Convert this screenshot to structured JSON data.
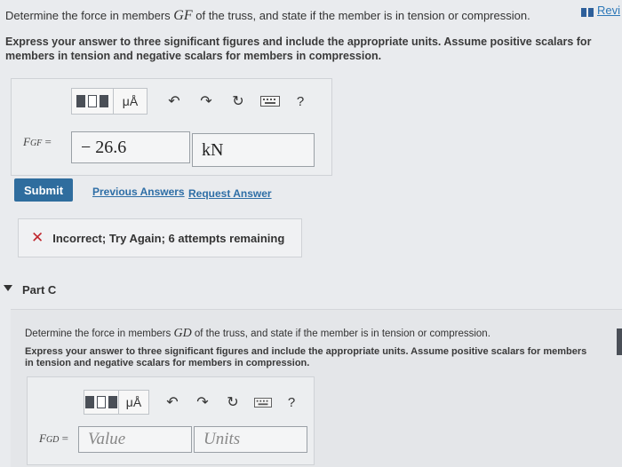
{
  "header": {
    "review_link": "Revi"
  },
  "partB": {
    "question_prefix": "Determine the force in members ",
    "question_var": "GF",
    "question_suffix": " of the truss, and state if the member is in tension or compression.",
    "instructions": "Express your answer to three significant figures and include the appropriate units. Assume positive scalars for members in tension and negative scalars for members in compression.",
    "toolbar": {
      "units_label": "μÅ",
      "undo_icon": "undo-icon",
      "redo_icon": "redo-icon",
      "reset_icon": "reset-icon",
      "keyboard_icon": "keyboard-icon",
      "help_label": "?"
    },
    "variable_label": "F",
    "variable_sub": "GF",
    "equals": "=",
    "value": "− 26.6",
    "units": "kN",
    "submit_label": "Submit",
    "previous_answers_label": "Previous Answers",
    "request_answer_label": "Request Answer",
    "feedback_icon": "✕",
    "feedback_text": "Incorrect; Try Again; 6 attempts remaining"
  },
  "partC": {
    "title": "Part C",
    "question_prefix": "Determine the force in members ",
    "question_var": "GD",
    "question_suffix": " of the truss, and state if the member is in tension or compression.",
    "instructions": "Express your answer to three significant figures and include the appropriate units. Assume positive scalars for members in tension and negative scalars for members in compression.",
    "toolbar": {
      "units_label": "μÅ",
      "help_label": "?"
    },
    "variable_label": "F",
    "variable_sub": "GD",
    "equals": "=",
    "value_placeholder": "Value",
    "units_placeholder": "Units"
  },
  "colors": {
    "submit_bg": "#2f6d9e",
    "link": "#2e6ea6",
    "error": "#c0262d",
    "background": "#e9ebee"
  }
}
